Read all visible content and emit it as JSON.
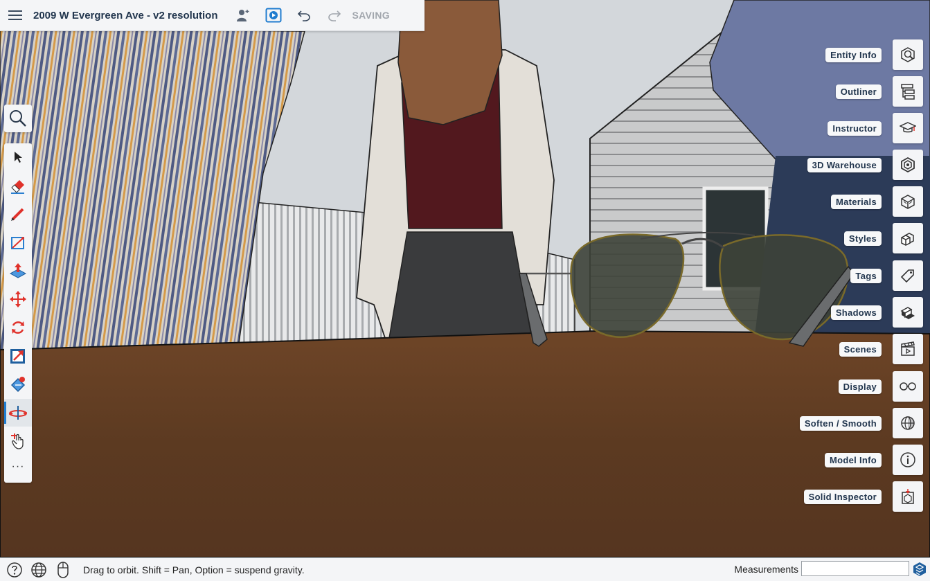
{
  "header": {
    "title": "2009 W Evergreen Ave - v2 resolution",
    "status": "SAVING",
    "icons": [
      "hamburger-menu-icon",
      "add-collaborator-icon",
      "play-scene-icon",
      "undo-icon",
      "redo-icon"
    ]
  },
  "left_toolbar": {
    "search_icon": "magnifier-icon",
    "tools": [
      "select-arrow-icon",
      "eraser-icon",
      "pencil-icon",
      "rectangle-icon",
      "push-pull-icon",
      "move-icon",
      "rotate-icon",
      "scale-icon",
      "paint-bucket-icon",
      "walk-icon",
      "position-camera-icon"
    ],
    "more": "···",
    "active_tool": "walk-icon"
  },
  "right_panels": {
    "items": [
      {
        "label": "Entity Info",
        "icon": "entity-info-icon"
      },
      {
        "label": "Outliner",
        "icon": "outliner-icon"
      },
      {
        "label": "Instructor",
        "icon": "graduation-cap-icon"
      },
      {
        "label": "3D Warehouse",
        "icon": "warehouse-icon"
      },
      {
        "label": "Materials",
        "icon": "materials-cube-icon"
      },
      {
        "label": "Styles",
        "icon": "styles-cubes-icon"
      },
      {
        "label": "Tags",
        "icon": "tag-icon"
      },
      {
        "label": "Shadows",
        "icon": "shadow-box-icon"
      },
      {
        "label": "Scenes",
        "icon": "clapperboard-icon"
      },
      {
        "label": "Display",
        "icon": "glasses-icon"
      },
      {
        "label": "Soften / Smooth",
        "icon": "sphere-icon"
      },
      {
        "label": "Model Info",
        "icon": "info-icon"
      },
      {
        "label": "Solid Inspector",
        "icon": "solid-inspector-icon"
      }
    ]
  },
  "status_bar": {
    "hint": "Drag to orbit. Shift = Pan, Option = suspend gravity.",
    "measurements_label": "Measurements",
    "measurements_value": "",
    "icons": [
      "help-icon",
      "globe-icon",
      "mouse-icon",
      "sketchup-logo-icon"
    ]
  },
  "colors": {
    "title": "#22364e",
    "accent": "#1f7ccf",
    "tool_red": "#e0322b",
    "panel_bg": "#f4f5f7",
    "saving": "#a1a6ad",
    "table": "#5a3a22"
  }
}
